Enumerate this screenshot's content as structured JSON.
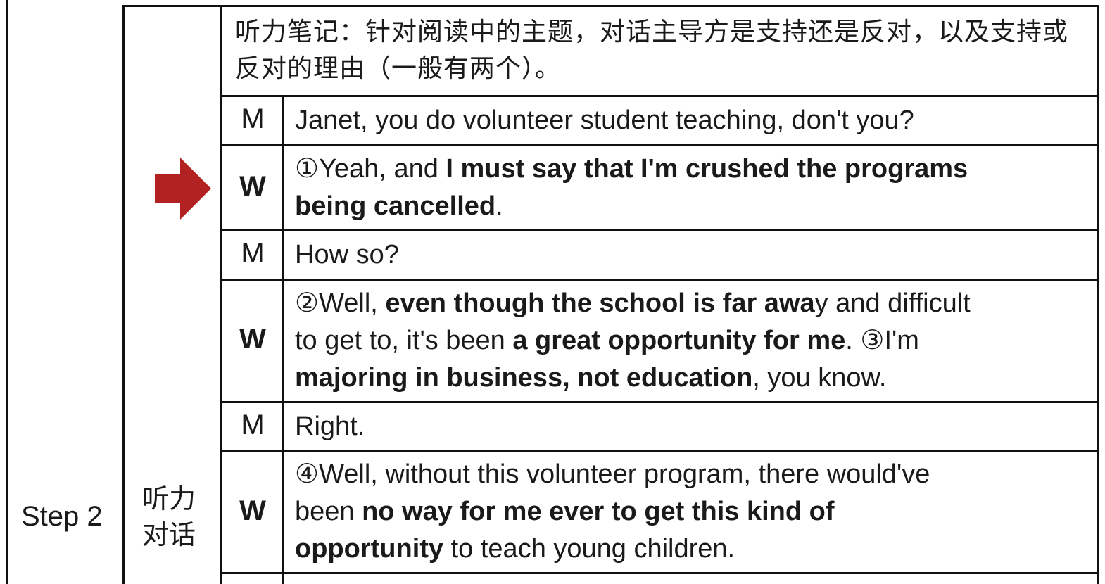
{
  "step": "Step 2",
  "phase": "听力对话",
  "instruction": "听力笔记：针对阅读中的主题，对话主导方是支持还是反对，以及支持或反对的理由（一般有两个）。",
  "rows": [
    {
      "speaker": "M",
      "bold": false,
      "lines": [
        [
          {
            "t": "Janet, you do volunteer student teaching, don't you?"
          }
        ]
      ]
    },
    {
      "speaker": "W",
      "bold": true,
      "lines": [
        [
          {
            "t": "①Yeah, and "
          },
          {
            "t": "I must say that I'm crushed the programs",
            "b": true
          }
        ],
        [
          {
            "t": "being cancelled",
            "b": true
          },
          {
            "t": "."
          }
        ]
      ]
    },
    {
      "speaker": "M",
      "bold": false,
      "lines": [
        [
          {
            "t": "How so?"
          }
        ]
      ]
    },
    {
      "speaker": "W",
      "bold": true,
      "lines": [
        [
          {
            "t": "②Well, "
          },
          {
            "t": "even though the school is far awa",
            "b": true
          },
          {
            "t": "y and difficult"
          }
        ],
        [
          {
            "t": "to get to, it's been "
          },
          {
            "t": "a great opportunity for me",
            "b": true
          },
          {
            "t": ". ③I'm"
          }
        ],
        [
          {
            "t": "majoring in business, not education",
            "b": true
          },
          {
            "t": ", you know."
          }
        ]
      ]
    },
    {
      "speaker": "M",
      "bold": false,
      "lines": [
        [
          {
            "t": "Right."
          }
        ]
      ]
    },
    {
      "speaker": "W",
      "bold": true,
      "lines": [
        [
          {
            "t": "④Well, without this volunteer program, there would've"
          }
        ],
        [
          {
            "t": "been "
          },
          {
            "t": "no way for me ever to get this kind of",
            "b": true
          }
        ],
        [
          {
            "t": "opportunity",
            "b": true
          },
          {
            "t": " to teach young children."
          }
        ]
      ]
    }
  ],
  "arrow": {
    "icon": "right-arrow-icon",
    "color": "#b22222"
  }
}
